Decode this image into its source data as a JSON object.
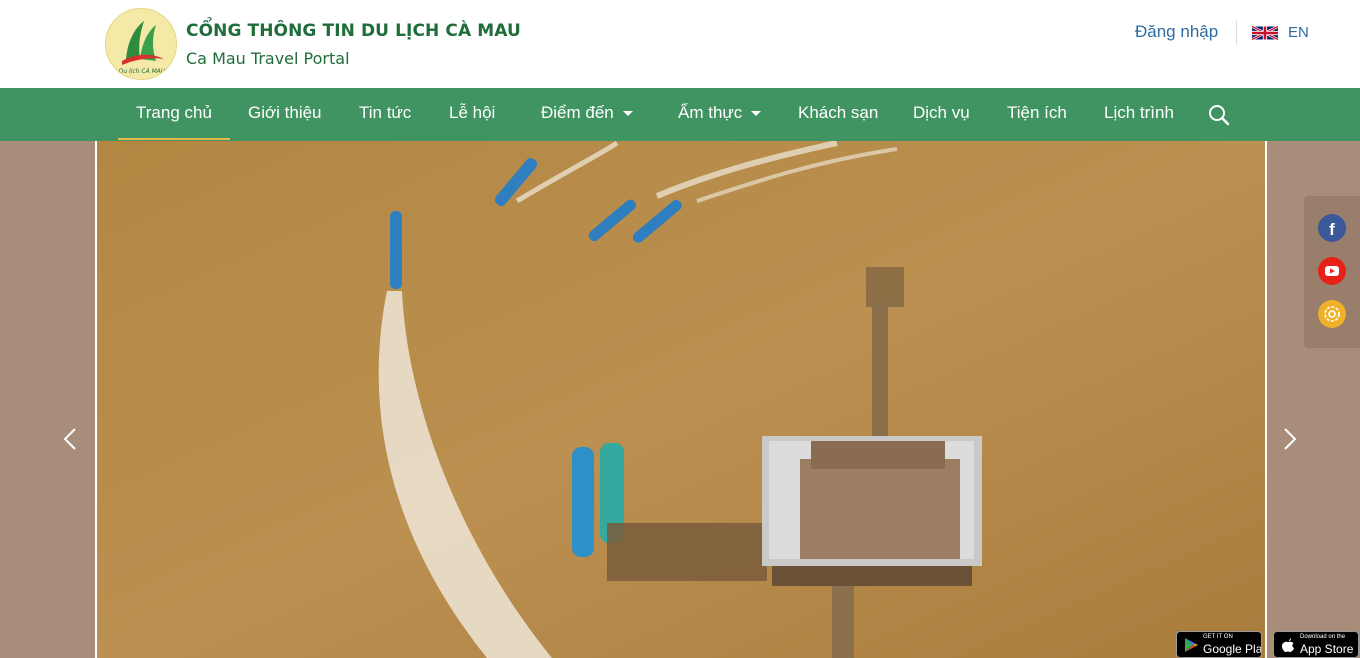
{
  "header": {
    "title": "CỔNG THÔNG TIN DU LỊCH CÀ MAU",
    "subtitle": "Ca Mau Travel Portal",
    "logo_text": "Du lịch CÀ MAU",
    "login_label": "Đăng nhập",
    "language_code": "EN"
  },
  "nav": {
    "items": [
      {
        "label": "Trang chủ",
        "active": true
      },
      {
        "label": "Giới thiệu"
      },
      {
        "label": "Tin tức"
      },
      {
        "label": "Lễ hội"
      },
      {
        "label": "Điểm đến",
        "dropdown": true
      },
      {
        "label": "Ẩm thực",
        "dropdown": true
      },
      {
        "label": "Khách sạn"
      },
      {
        "label": "Dịch vụ"
      },
      {
        "label": "Tiện ích"
      },
      {
        "label": "Lịch trình"
      }
    ],
    "search_icon": "search-icon"
  },
  "social": {
    "icons": [
      "facebook-icon",
      "youtube-icon",
      "settings-icon"
    ],
    "colors": {
      "facebook": "#3b5998",
      "youtube": "#e62117",
      "settings": "#f0b12a"
    }
  },
  "apps": {
    "google_play": {
      "small": "GET IT ON",
      "big": "Google Play"
    },
    "app_store": {
      "small": "Download on the",
      "big": "App Store"
    }
  },
  "colors": {
    "nav_bg": "#3f9462",
    "brand_green": "#1f6d3a",
    "link_blue": "#2d6ba0",
    "active_underline": "#e8b84a",
    "slider_side_bg": "#a88d7a"
  }
}
